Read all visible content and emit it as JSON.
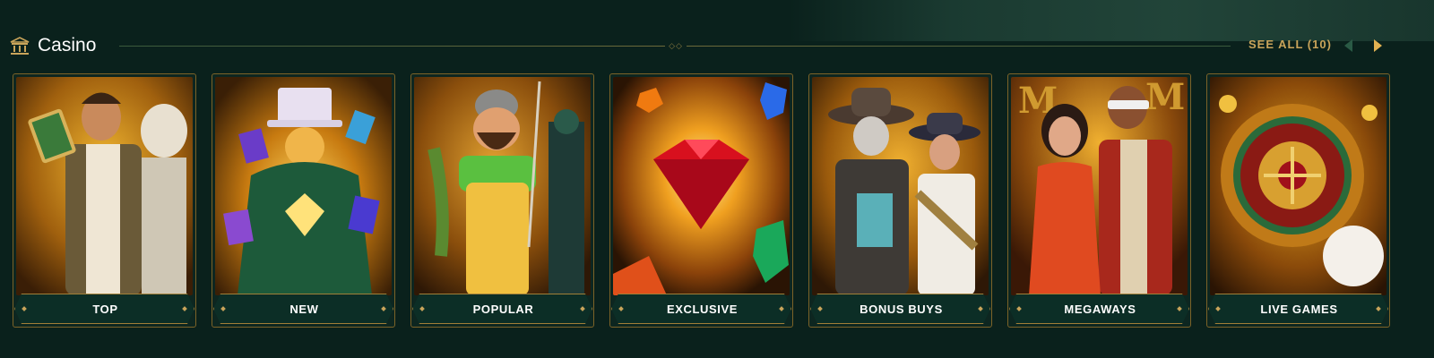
{
  "section": {
    "title": "Casino",
    "icon": "casino-building-icon",
    "see_all_label": "SEE ALL (10)",
    "prev_icon": "chevron-left-icon",
    "next_icon": "chevron-right-icon"
  },
  "categories": [
    {
      "label": "TOP",
      "art": "adventurer-and-zeus-art"
    },
    {
      "label": "NEW",
      "art": "magician-with-cards-art"
    },
    {
      "label": "POPULAR",
      "art": "fisherman-art"
    },
    {
      "label": "EXCLUSIVE",
      "art": "red-diamond-art"
    },
    {
      "label": "BONUS BUYS",
      "art": "cowboy-bandits-art"
    },
    {
      "label": "MEGAWAYS",
      "art": "couple-characters-art"
    },
    {
      "label": "LIVE GAMES",
      "art": "roulette-wheel-art"
    }
  ],
  "colors": {
    "background": "#0a211c",
    "gold": "#c9a45a",
    "label_bar": "#0c2e26"
  }
}
